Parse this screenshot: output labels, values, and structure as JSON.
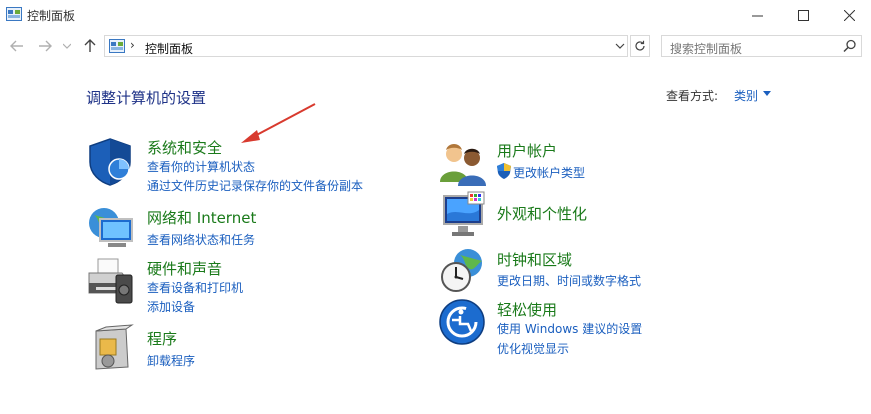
{
  "window": {
    "title": "控制面板",
    "minimize_glyph": "—",
    "maximize_glyph": "☐",
    "close_glyph": "✕"
  },
  "nav": {
    "back_glyph": "←",
    "forward_glyph": "→",
    "recent_glyph": "⌄",
    "up_glyph": "↑"
  },
  "address": {
    "separator": "›",
    "path": "控制面板"
  },
  "search": {
    "placeholder": "搜索控制面板"
  },
  "header": {
    "heading": "调整计算机的设置",
    "view_by_label": "查看方式:",
    "view_by_value": "类别"
  },
  "colors": {
    "heading": "#1e3287",
    "category_title": "#1a7a1a",
    "link": "#1b5fbf",
    "arrow": "#d83a2e"
  },
  "categories_left": [
    {
      "icon": "shield-icon",
      "title": "系统和安全",
      "links": [
        "查看你的计算机状态",
        "通过文件历史记录保存你的文件备份副本"
      ]
    },
    {
      "icon": "network-icon",
      "title": "网络和 Internet",
      "links": [
        "查看网络状态和任务"
      ]
    },
    {
      "icon": "printer-icon",
      "title": "硬件和声音",
      "links": [
        "查看设备和打印机",
        "添加设备"
      ]
    },
    {
      "icon": "programs-icon",
      "title": "程序",
      "links": [
        "卸载程序"
      ]
    }
  ],
  "categories_right": [
    {
      "icon": "users-icon",
      "title": "用户帐户",
      "links": [
        "更改帐户类型"
      ]
    },
    {
      "icon": "monitor-icon",
      "title": "外观和个性化",
      "links": []
    },
    {
      "icon": "clock-globe-icon",
      "title": "时钟和区域",
      "links": [
        "更改日期、时间或数字格式"
      ]
    },
    {
      "icon": "ease-of-access-icon",
      "title": "轻松使用",
      "links": [
        "使用 Windows 建议的设置",
        "优化视觉显示"
      ]
    }
  ]
}
